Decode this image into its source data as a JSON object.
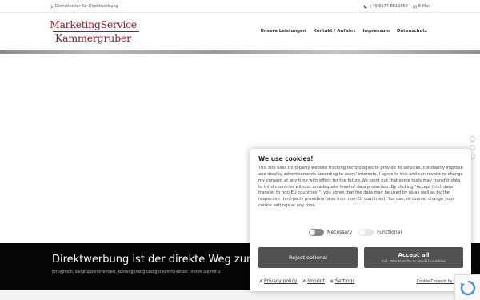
{
  "topbar": {
    "tagline": "Dienstleister für Direktwerbung",
    "phone": "+49 8677 8819850",
    "email": "E-Mail"
  },
  "logo": {
    "line1": "MarketingService",
    "line2": "Kammergruber"
  },
  "nav": {
    "items": [
      "Unsere Leistungen",
      "Kontakt / Anfahrt",
      "Impressum",
      "Datenschutz"
    ]
  },
  "banner": {
    "heading": "Direktwerbung ist der direkte Weg zum Ku",
    "subtext": "Erfolgreich, zielgruppenorientiert, kostengünstig und gut kontrollierbar. Treten Sie mit u"
  },
  "cookie": {
    "title": "We use cookies!",
    "body": "This site uses third-party website tracking technologies to provide its services, constantly improve and display advertisements according to users' interests. I agree to this and can revoke or change my consent at any time with effect for the future.We point out that some tools may transfer data to third countries without an adequate level of data protection. By clicking \"Accept (incl. data transfer to non-EU countries)\", you agree that the data may be used by us as well as by the respective third-party providers (also from non-EU countries). You can, of course, change your cookie settings at any time.",
    "toggle_necessary": "Necessary",
    "toggle_functional": "Functional",
    "reject_label": "Reject optional",
    "accept_label": "Accept all",
    "accept_sub": "incl. data transfer to non-EU countries",
    "link_privacy": "Privacy policy",
    "link_imprint": "Imprint",
    "link_settings": "Settings",
    "brand": "Cookie Consent by Prive"
  },
  "colors": {
    "brand": "#8b1a2b",
    "button": "#515151",
    "banner_bg": "#050505"
  }
}
